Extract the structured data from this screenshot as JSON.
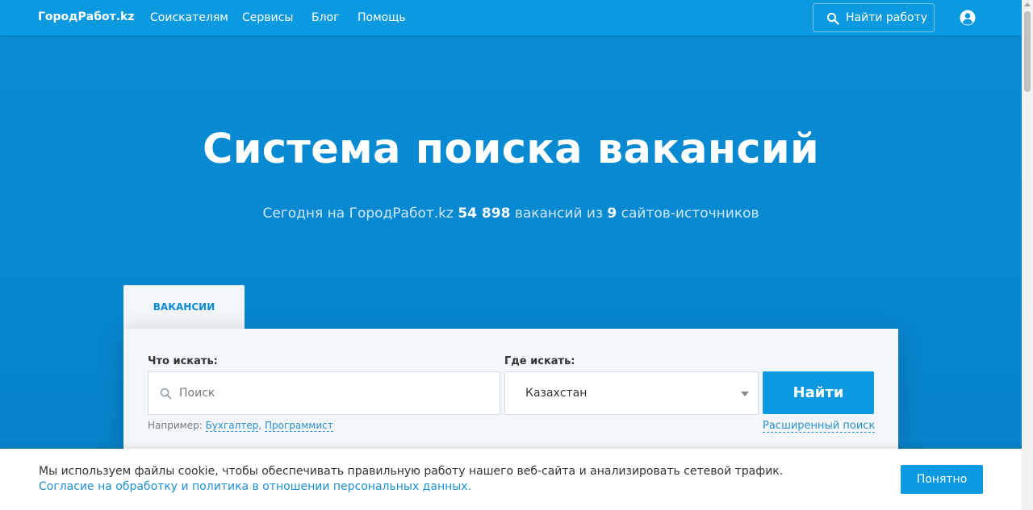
{
  "header": {
    "logo": "ГородРабот.kz",
    "nav": [
      "Соискателям",
      "Сервисы",
      "Блог",
      "Помощь"
    ],
    "find_job_label": "Найти работу"
  },
  "hero": {
    "title": "Система поиска вакансий",
    "sub_prefix": "Сегодня на ГородРабот.kz",
    "vacancy_count": "54 898",
    "sub_mid": "вакансий из",
    "source_count": "9",
    "sub_suffix": "сайтов-источников"
  },
  "search": {
    "tab_label": "ВАКАНСИИ",
    "what_label": "Что искать:",
    "where_label": "Где искать:",
    "query_placeholder": "Поиск",
    "query_value": "",
    "location_value": "Казахстан",
    "submit_label": "Найти",
    "examples_prefix": "Например:",
    "examples": [
      "Бухгалтер",
      "Программист"
    ],
    "advanced_label": "Расширенный поиск"
  },
  "cookie": {
    "text": "Мы используем файлы cookie, чтобы обеспечивать правильную работу нашего веб-сайта и анализировать сетевой трафик.",
    "link": "Согласие на обработку и политика в отношении персональных данных.",
    "accept_label": "Понятно"
  },
  "colors": {
    "brand_blue": "#0b9ae0",
    "hero_blue": "#0789d1",
    "link_blue": "#2a8fcc"
  }
}
